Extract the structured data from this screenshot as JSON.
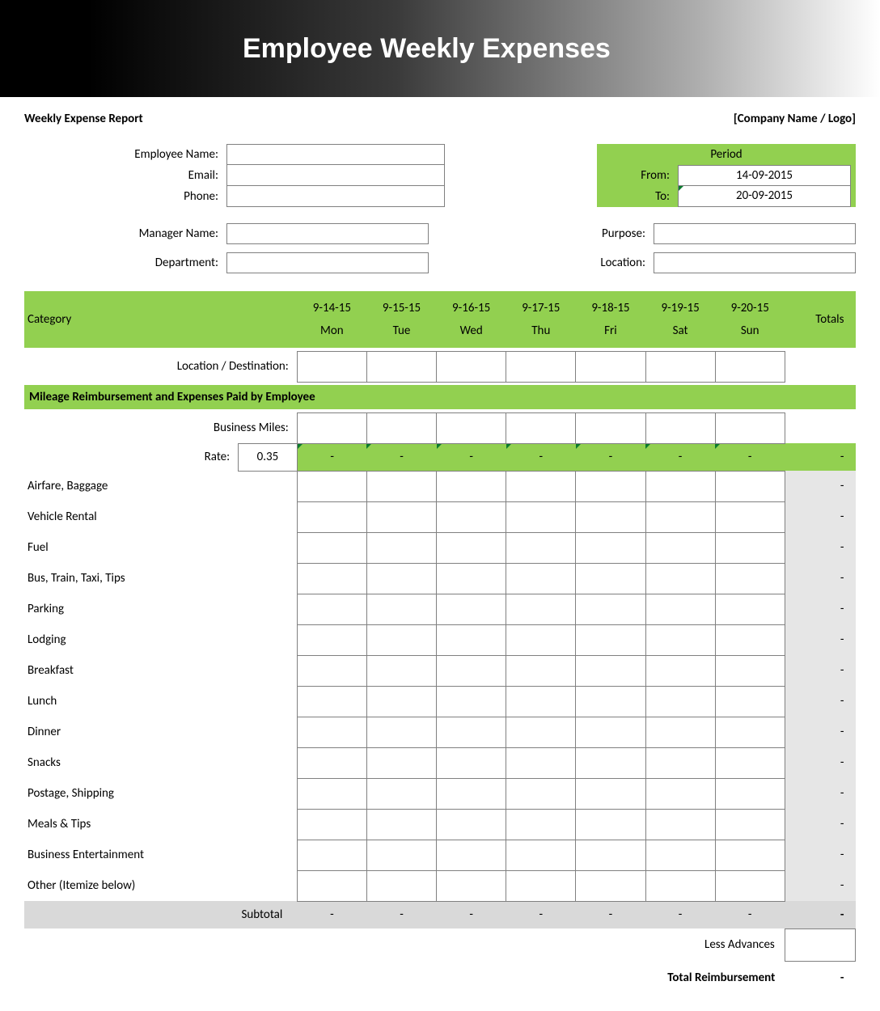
{
  "banner": {
    "title": "Employee Weekly Expenses"
  },
  "header": {
    "report_title": "Weekly Expense Report",
    "company_placeholder": "[Company Name / Logo]"
  },
  "employee": {
    "name_label": "Employee Name:",
    "email_label": "Email:",
    "phone_label": "Phone:",
    "name": "",
    "email": "",
    "phone": ""
  },
  "period": {
    "header": "Period",
    "from_label": "From:",
    "to_label": "To:",
    "from": "14-09-2015",
    "to": "20-09-2015"
  },
  "manager": {
    "name_label": "Manager Name:",
    "department_label": "Department:",
    "name": "",
    "department": ""
  },
  "trip": {
    "purpose_label": "Purpose:",
    "location_label": "Location:",
    "purpose": "",
    "location": ""
  },
  "grid": {
    "category_label": "Category",
    "totals_label": "Totals",
    "days": [
      {
        "date": "9-14-15",
        "dow": "Mon"
      },
      {
        "date": "9-15-15",
        "dow": "Tue"
      },
      {
        "date": "9-16-15",
        "dow": "Wed"
      },
      {
        "date": "9-17-15",
        "dow": "Thu"
      },
      {
        "date": "9-18-15",
        "dow": "Fri"
      },
      {
        "date": "9-19-15",
        "dow": "Sat"
      },
      {
        "date": "9-20-15",
        "dow": "Sun"
      }
    ],
    "location_destination_label": "Location / Destination:",
    "section1_title": "Mileage Reimbursement and Expenses Paid by Employee",
    "business_miles_label": "Business Miles:",
    "rate_label": "Rate:",
    "rate_value": "0.35",
    "rate_row_day_value": "-",
    "rate_row_total": "-",
    "expense_rows": [
      {
        "name": "Airfare, Baggage",
        "total": "-"
      },
      {
        "name": "Vehicle Rental",
        "total": "-"
      },
      {
        "name": "Fuel",
        "total": "-"
      },
      {
        "name": "Bus, Train, Taxi, Tips",
        "total": "-"
      },
      {
        "name": "Parking",
        "total": "-"
      },
      {
        "name": "Lodging",
        "total": "-"
      },
      {
        "name": "Breakfast",
        "total": "-"
      },
      {
        "name": "Lunch",
        "total": "-"
      },
      {
        "name": "Dinner",
        "total": "-"
      },
      {
        "name": "Snacks",
        "total": "-"
      },
      {
        "name": "Postage, Shipping",
        "total": "-"
      },
      {
        "name": "Meals & Tips",
        "total": "-"
      },
      {
        "name": "Business Entertainment",
        "total": "-"
      },
      {
        "name": "Other (Itemize below)",
        "total": "-"
      }
    ],
    "subtotal_label": "Subtotal",
    "subtotal_day_value": "-",
    "subtotal_total": "-",
    "less_advances_label": "Less Advances",
    "less_advances_value": "",
    "total_reimbursement_label": "Total Reimbursement",
    "total_reimbursement_value": "-"
  }
}
